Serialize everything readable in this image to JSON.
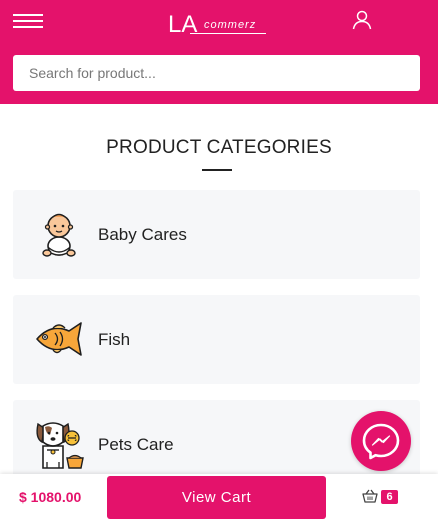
{
  "header": {
    "logo_main": "LA",
    "logo_sub": "commerz",
    "menu_icon": "hamburger-menu-icon",
    "account_icon": "user-icon"
  },
  "search": {
    "placeholder": "Search for product..."
  },
  "categories_section": {
    "title": "PRODUCT CATEGORIES",
    "items": [
      {
        "label": "Baby Cares",
        "icon": "baby-icon"
      },
      {
        "label": "Fish",
        "icon": "fish-icon"
      },
      {
        "label": "Pets Care",
        "icon": "dog-icon"
      }
    ]
  },
  "messenger": {
    "icon": "messenger-icon"
  },
  "cart_bar": {
    "total": "$ 1080.00",
    "view_cart_label": "View Cart",
    "basket_icon": "basket-icon",
    "item_count": "6"
  },
  "colors": {
    "brand": "#e4126b",
    "card_background": "#f6f7f9",
    "text": "#222222"
  }
}
